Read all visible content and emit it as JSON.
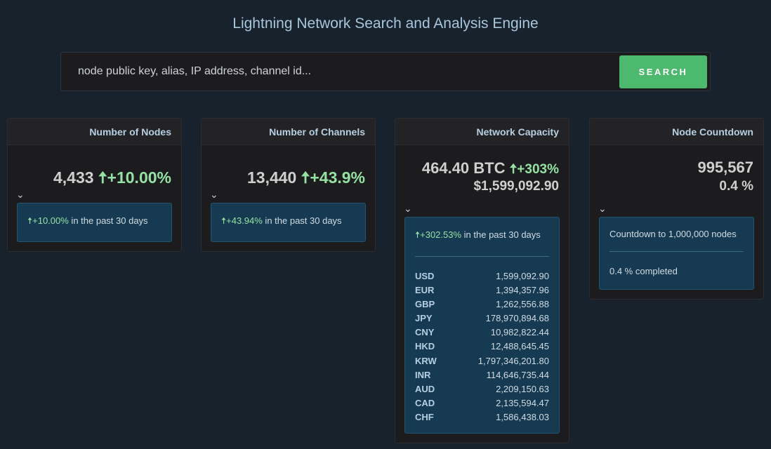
{
  "title": "Lightning Network Search and Analysis Engine",
  "search": {
    "placeholder": "node public key, alias, IP address, channel id...",
    "button": "SEARCH"
  },
  "cards": [
    {
      "title": "Number of Nodes",
      "value": "4,433",
      "change": "+10.00%",
      "detail_change": "+10.00%",
      "detail_text": " in the past 30 days"
    },
    {
      "title": "Number of Channels",
      "value": "13,440",
      "change": "+43.9%",
      "detail_change": "+43.94%",
      "detail_text": " in the past 30 days"
    },
    {
      "title": "Network Capacity",
      "value": "464.40 BTC",
      "change": "+303%",
      "usd": "$1,599,092.90",
      "detail_change": "+302.53%",
      "detail_text": " in the past 30 days",
      "currencies": [
        [
          "USD",
          "1,599,092.90"
        ],
        [
          "EUR",
          "1,394,357.96"
        ],
        [
          "GBP",
          "1,262,556.88"
        ],
        [
          "JPY",
          "178,970,894.68"
        ],
        [
          "CNY",
          "10,982,822.44"
        ],
        [
          "HKD",
          "12,488,645.45"
        ],
        [
          "KRW",
          "1,797,346,201.80"
        ],
        [
          "INR",
          "114,646,735.44"
        ],
        [
          "AUD",
          "2,209,150.63"
        ],
        [
          "CAD",
          "2,135,594.47"
        ],
        [
          "CHF",
          "1,586,438.03"
        ]
      ]
    },
    {
      "title": "Node Countdown",
      "value": "995,567",
      "percent": "0.4 %",
      "detail_text": "Countdown to 1,000,000 nodes",
      "completed": "0.4 % completed"
    }
  ]
}
